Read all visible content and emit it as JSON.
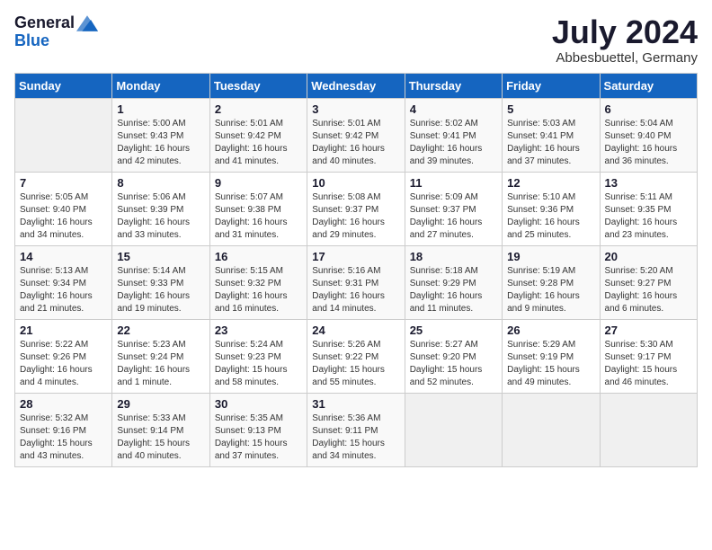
{
  "header": {
    "logo_general": "General",
    "logo_blue": "Blue",
    "title": "July 2024",
    "location": "Abbesbuettel, Germany"
  },
  "days_of_week": [
    "Sunday",
    "Monday",
    "Tuesday",
    "Wednesday",
    "Thursday",
    "Friday",
    "Saturday"
  ],
  "weeks": [
    [
      {
        "day": "",
        "info": ""
      },
      {
        "day": "1",
        "info": "Sunrise: 5:00 AM\nSunset: 9:43 PM\nDaylight: 16 hours\nand 42 minutes."
      },
      {
        "day": "2",
        "info": "Sunrise: 5:01 AM\nSunset: 9:42 PM\nDaylight: 16 hours\nand 41 minutes."
      },
      {
        "day": "3",
        "info": "Sunrise: 5:01 AM\nSunset: 9:42 PM\nDaylight: 16 hours\nand 40 minutes."
      },
      {
        "day": "4",
        "info": "Sunrise: 5:02 AM\nSunset: 9:41 PM\nDaylight: 16 hours\nand 39 minutes."
      },
      {
        "day": "5",
        "info": "Sunrise: 5:03 AM\nSunset: 9:41 PM\nDaylight: 16 hours\nand 37 minutes."
      },
      {
        "day": "6",
        "info": "Sunrise: 5:04 AM\nSunset: 9:40 PM\nDaylight: 16 hours\nand 36 minutes."
      }
    ],
    [
      {
        "day": "7",
        "info": "Sunrise: 5:05 AM\nSunset: 9:40 PM\nDaylight: 16 hours\nand 34 minutes."
      },
      {
        "day": "8",
        "info": "Sunrise: 5:06 AM\nSunset: 9:39 PM\nDaylight: 16 hours\nand 33 minutes."
      },
      {
        "day": "9",
        "info": "Sunrise: 5:07 AM\nSunset: 9:38 PM\nDaylight: 16 hours\nand 31 minutes."
      },
      {
        "day": "10",
        "info": "Sunrise: 5:08 AM\nSunset: 9:37 PM\nDaylight: 16 hours\nand 29 minutes."
      },
      {
        "day": "11",
        "info": "Sunrise: 5:09 AM\nSunset: 9:37 PM\nDaylight: 16 hours\nand 27 minutes."
      },
      {
        "day": "12",
        "info": "Sunrise: 5:10 AM\nSunset: 9:36 PM\nDaylight: 16 hours\nand 25 minutes."
      },
      {
        "day": "13",
        "info": "Sunrise: 5:11 AM\nSunset: 9:35 PM\nDaylight: 16 hours\nand 23 minutes."
      }
    ],
    [
      {
        "day": "14",
        "info": "Sunrise: 5:13 AM\nSunset: 9:34 PM\nDaylight: 16 hours\nand 21 minutes."
      },
      {
        "day": "15",
        "info": "Sunrise: 5:14 AM\nSunset: 9:33 PM\nDaylight: 16 hours\nand 19 minutes."
      },
      {
        "day": "16",
        "info": "Sunrise: 5:15 AM\nSunset: 9:32 PM\nDaylight: 16 hours\nand 16 minutes."
      },
      {
        "day": "17",
        "info": "Sunrise: 5:16 AM\nSunset: 9:31 PM\nDaylight: 16 hours\nand 14 minutes."
      },
      {
        "day": "18",
        "info": "Sunrise: 5:18 AM\nSunset: 9:29 PM\nDaylight: 16 hours\nand 11 minutes."
      },
      {
        "day": "19",
        "info": "Sunrise: 5:19 AM\nSunset: 9:28 PM\nDaylight: 16 hours\nand 9 minutes."
      },
      {
        "day": "20",
        "info": "Sunrise: 5:20 AM\nSunset: 9:27 PM\nDaylight: 16 hours\nand 6 minutes."
      }
    ],
    [
      {
        "day": "21",
        "info": "Sunrise: 5:22 AM\nSunset: 9:26 PM\nDaylight: 16 hours\nand 4 minutes."
      },
      {
        "day": "22",
        "info": "Sunrise: 5:23 AM\nSunset: 9:24 PM\nDaylight: 16 hours\nand 1 minute."
      },
      {
        "day": "23",
        "info": "Sunrise: 5:24 AM\nSunset: 9:23 PM\nDaylight: 15 hours\nand 58 minutes."
      },
      {
        "day": "24",
        "info": "Sunrise: 5:26 AM\nSunset: 9:22 PM\nDaylight: 15 hours\nand 55 minutes."
      },
      {
        "day": "25",
        "info": "Sunrise: 5:27 AM\nSunset: 9:20 PM\nDaylight: 15 hours\nand 52 minutes."
      },
      {
        "day": "26",
        "info": "Sunrise: 5:29 AM\nSunset: 9:19 PM\nDaylight: 15 hours\nand 49 minutes."
      },
      {
        "day": "27",
        "info": "Sunrise: 5:30 AM\nSunset: 9:17 PM\nDaylight: 15 hours\nand 46 minutes."
      }
    ],
    [
      {
        "day": "28",
        "info": "Sunrise: 5:32 AM\nSunset: 9:16 PM\nDaylight: 15 hours\nand 43 minutes."
      },
      {
        "day": "29",
        "info": "Sunrise: 5:33 AM\nSunset: 9:14 PM\nDaylight: 15 hours\nand 40 minutes."
      },
      {
        "day": "30",
        "info": "Sunrise: 5:35 AM\nSunset: 9:13 PM\nDaylight: 15 hours\nand 37 minutes."
      },
      {
        "day": "31",
        "info": "Sunrise: 5:36 AM\nSunset: 9:11 PM\nDaylight: 15 hours\nand 34 minutes."
      },
      {
        "day": "",
        "info": ""
      },
      {
        "day": "",
        "info": ""
      },
      {
        "day": "",
        "info": ""
      }
    ]
  ]
}
